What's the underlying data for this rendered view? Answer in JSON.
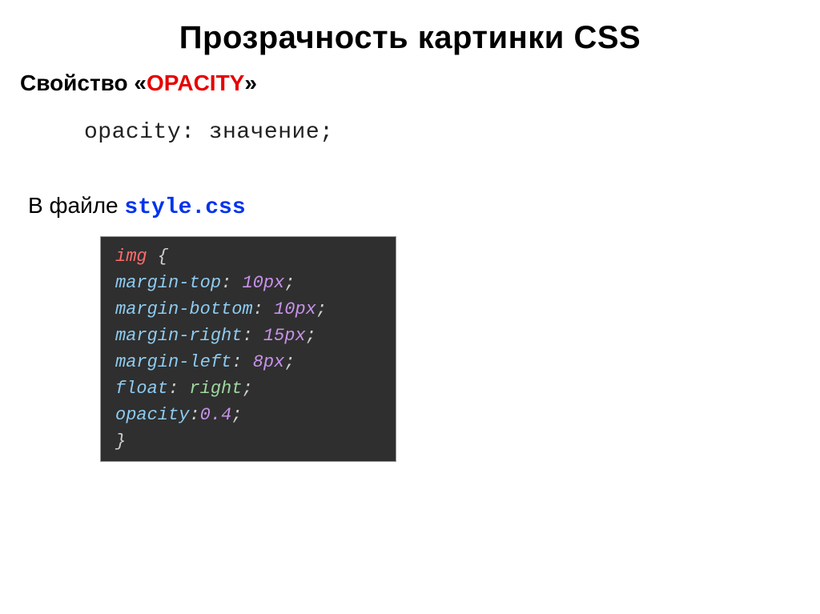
{
  "title": "Прозрачность картинки CSS",
  "property": {
    "prefix": "Свойство «",
    "name": "OPACITY",
    "suffix": "»"
  },
  "syntax": "opacity: значение;",
  "file_line": {
    "prefix": "В файле ",
    "filename": "style.css"
  },
  "code": {
    "selector": "img",
    "open_brace": " {",
    "lines": [
      {
        "prop": "margin-top",
        "value": "10px",
        "value_type": "num"
      },
      {
        "prop": "margin-bottom",
        "value": "10px",
        "value_type": "num"
      },
      {
        "prop": "margin-right",
        "value": "15px",
        "value_type": "num"
      },
      {
        "prop": "margin-left",
        "value": "8px",
        "value_type": "num"
      },
      {
        "prop": "float",
        "value": "right",
        "value_type": "word"
      },
      {
        "prop": "opacity",
        "value": "0.4",
        "value_type": "num"
      }
    ],
    "close_brace": "}"
  }
}
